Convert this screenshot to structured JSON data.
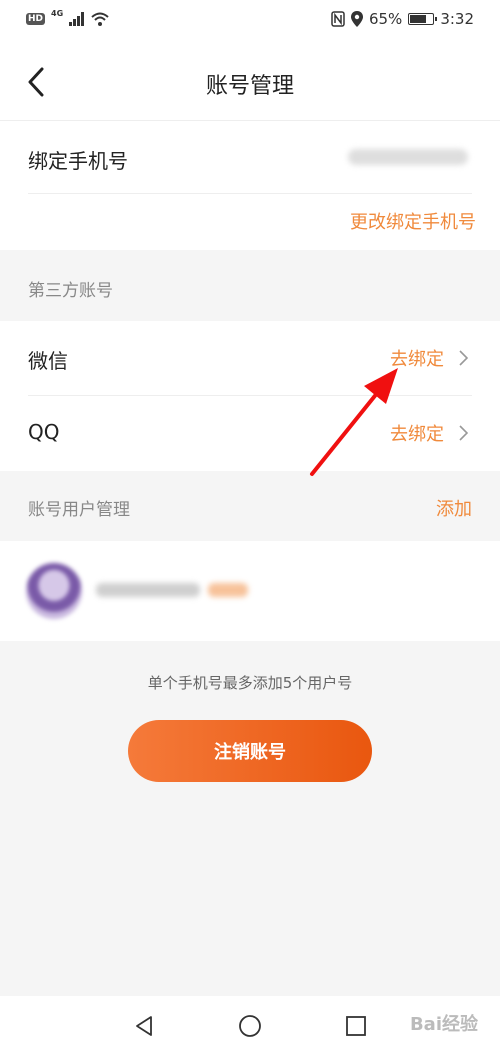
{
  "status_bar": {
    "hd": "HD",
    "network": "4G",
    "battery_percent": "65%",
    "battery_level": 0.65,
    "time": "3:32",
    "icons": [
      "signal-icon",
      "wifi-icon",
      "nfc-icon",
      "location-icon",
      "battery-icon"
    ]
  },
  "header": {
    "title": "账号管理"
  },
  "phone_binding": {
    "label": "绑定手机号",
    "change_link": "更改绑定手机号"
  },
  "third_party": {
    "section_title": "第三方账号",
    "accounts": [
      {
        "name": "微信",
        "action": "去绑定"
      },
      {
        "name": "QQ",
        "action": "去绑定"
      }
    ]
  },
  "account_users": {
    "section_title": "账号用户管理",
    "add_label": "添加"
  },
  "limit_note": "单个手机号最多添加5个用户号",
  "cancel_button": "注销账号",
  "colors": {
    "accent": "#f08a3c",
    "button_start": "#f57a3a",
    "button_end": "#e9570f",
    "annotation_arrow": "#f01010"
  },
  "watermark": "Bai经验"
}
